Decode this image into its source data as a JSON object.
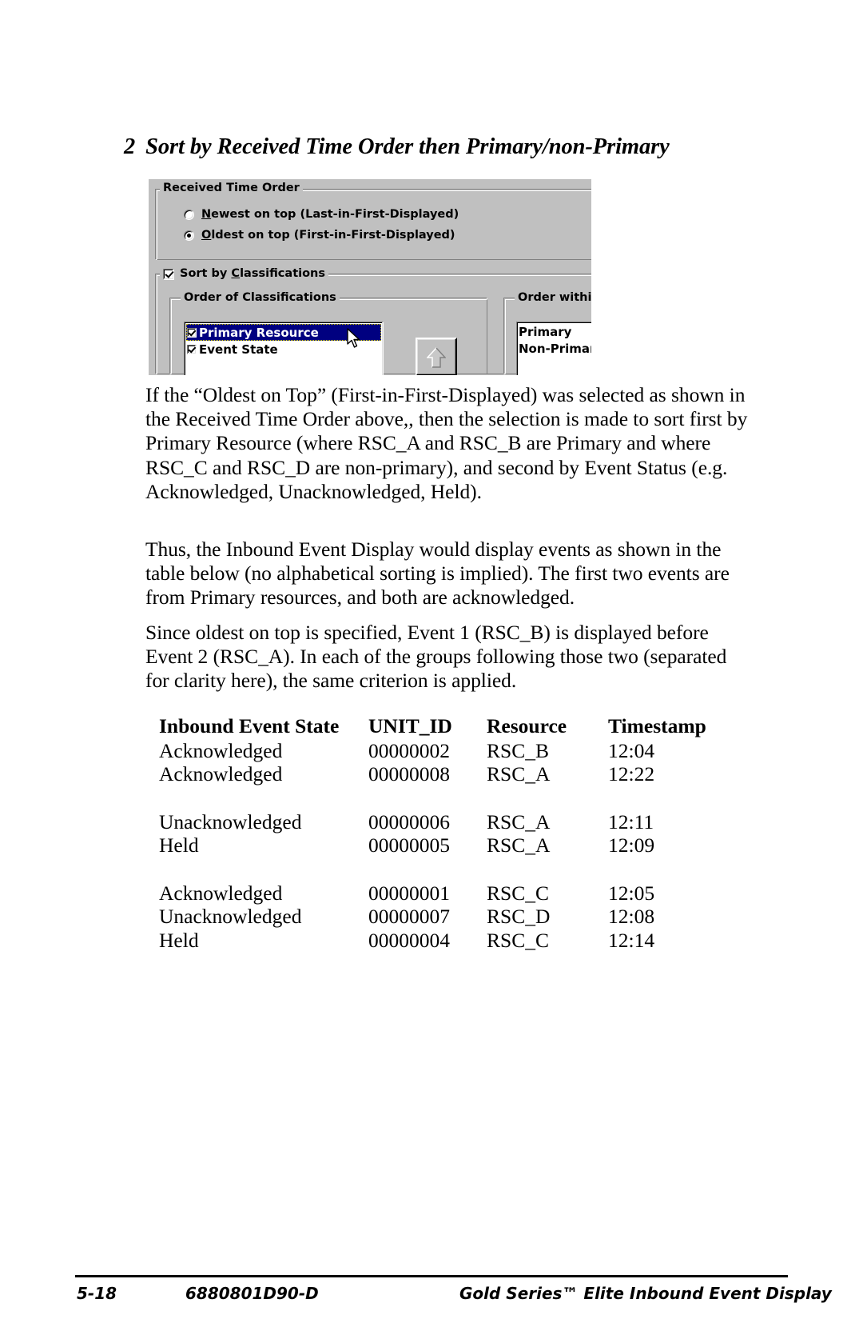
{
  "heading": {
    "number": "2",
    "text": "Sort by Received Time Order then Primary/non-Primary"
  },
  "dialog": {
    "received_time_order": {
      "group_title": "Received Time Order",
      "options": [
        {
          "label_pre": "",
          "accel": "N",
          "label_post": "ewest on top (Last-in-First-Displayed)",
          "selected": false
        },
        {
          "label_pre": "",
          "accel": "O",
          "label_post": "ldest on top (First-in-First-Displayed)",
          "selected": true
        }
      ]
    },
    "sort_by_classifications": {
      "group_title_pre": "Sort by ",
      "group_title_accel": "C",
      "group_title_post": "lassifications",
      "checked": true
    },
    "order_of_classifications": {
      "group_title": "Order of Classifications",
      "items": [
        {
          "label": "Primary Resource",
          "checked": true,
          "selected": true
        },
        {
          "label": "Event State",
          "checked": true,
          "selected": false
        }
      ]
    },
    "order_within": {
      "group_title": "Order within",
      "items": [
        {
          "label": "Primary"
        },
        {
          "label": "Non-Primar"
        }
      ]
    },
    "move_up_button": "move-up",
    "colors": {
      "face": "#c0c0c0",
      "selection": "#000080",
      "selection_text": "#ffffff",
      "field": "#ffffff"
    }
  },
  "paragraphs": {
    "p1": "If the “Oldest on Top” (First-in-First-Displayed) was selected as shown in the Received Time Order above,, then the selection is made to sort first by Primary Resource (where RSC_A and RSC_B are Primary and where RSC_C and RSC_D are non-primary), and second by Event Status (e.g. Acknowledged, Unacknowledged, Held).",
    "p2": "Thus, the Inbound Event Display would display events as shown in the table below (no alphabetical sorting is implied). The first two events are from Primary resources, and both are acknowledged.",
    "p3": "Since oldest on top is specified, Event 1 (RSC_B) is displayed before Event 2 (RSC_A).  In each of the groups following those two (separated for clarity here), the same criterion is applied."
  },
  "table": {
    "headers": [
      "Inbound Event State",
      "UNIT_ID",
      "Resource",
      "Timestamp"
    ],
    "groups": [
      [
        {
          "state": "Acknowledged",
          "unit_id": "00000002",
          "resource": "RSC_B",
          "timestamp": "12:04"
        },
        {
          "state": "Acknowledged",
          "unit_id": "00000008",
          "resource": "RSC_A",
          "timestamp": "12:22"
        }
      ],
      [
        {
          "state": "Unacknowledged",
          "unit_id": "00000006",
          "resource": "RSC_A",
          "timestamp": "12:11"
        },
        {
          "state": "Held",
          "unit_id": "00000005",
          "resource": "RSC_A",
          "timestamp": "12:09"
        }
      ],
      [
        {
          "state": "Acknowledged",
          "unit_id": "00000001",
          "resource": "RSC_C",
          "timestamp": "12:05"
        },
        {
          "state": "Unacknowledged",
          "unit_id": "00000007",
          "resource": "RSC_D",
          "timestamp": "12:08"
        },
        {
          "state": "Held",
          "unit_id": "00000004",
          "resource": "RSC_C",
          "timestamp": "12:14"
        }
      ]
    ]
  },
  "footer": {
    "page_number": "5-18",
    "part_number": "6880801D90-D",
    "title": "Gold Series™ Elite Inbound Event Display"
  }
}
